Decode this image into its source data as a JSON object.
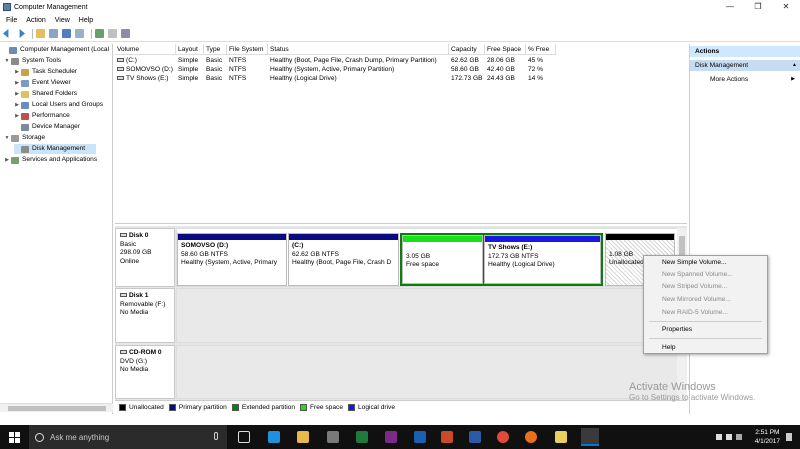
{
  "window": {
    "title": "Computer Management",
    "min_glyph": "—",
    "max_glyph": "❐",
    "close_glyph": "✕"
  },
  "menu": [
    "File",
    "Action",
    "View",
    "Help"
  ],
  "tree": {
    "items": [
      {
        "label": "Computer Management (Local",
        "exp": "",
        "indent": 0,
        "selected": false
      },
      {
        "label": "System Tools",
        "exp": "▼",
        "indent": 1,
        "selected": false
      },
      {
        "label": "Task Scheduler",
        "exp": "▶",
        "indent": 2,
        "selected": false
      },
      {
        "label": "Event Viewer",
        "exp": "▶",
        "indent": 2,
        "selected": false
      },
      {
        "label": "Shared Folders",
        "exp": "▶",
        "indent": 2,
        "selected": false
      },
      {
        "label": "Local Users and Groups",
        "exp": "▶",
        "indent": 2,
        "selected": false
      },
      {
        "label": "Performance",
        "exp": "▶",
        "indent": 2,
        "selected": false
      },
      {
        "label": "Device Manager",
        "exp": "",
        "indent": 2,
        "selected": false
      },
      {
        "label": "Storage",
        "exp": "▼",
        "indent": 1,
        "selected": false
      },
      {
        "label": "Disk Management",
        "exp": "",
        "indent": 2,
        "selected": true
      },
      {
        "label": "Services and Applications",
        "exp": "▶",
        "indent": 1,
        "selected": false
      }
    ]
  },
  "volumes": {
    "columns": [
      "Volume",
      "Layout",
      "Type",
      "File System",
      "Status",
      "Capacity",
      "Free Space",
      "% Free"
    ],
    "rows": [
      [
        "(C:)",
        "Simple",
        "Basic",
        "NTFS",
        "Healthy (Boot, Page File, Crash Dump, Primary Partition)",
        "62.62 GB",
        "28.06 GB",
        "45 %"
      ],
      [
        "SOMOVSO (D:)",
        "Simple",
        "Basic",
        "NTFS",
        "Healthy (System, Active, Primary Partition)",
        "58.60 GB",
        "42.40 GB",
        "72 %"
      ],
      [
        "TV Shows (E:)",
        "Simple",
        "Basic",
        "NTFS",
        "Healthy (Logical Drive)",
        "172.73 GB",
        "24.43 GB",
        "14 %"
      ]
    ]
  },
  "disks": [
    {
      "name": "Disk 0",
      "lines": [
        "Basic",
        "298.09 GB",
        "Online"
      ]
    },
    {
      "name": "Disk 1",
      "lines": [
        "Removable (F:)",
        "",
        "No Media"
      ]
    },
    {
      "name": "CD-ROM 0",
      "lines": [
        "DVD (G:)",
        "",
        "No Media"
      ]
    }
  ],
  "partitions": [
    {
      "title": "SOMOVSO  (D:)",
      "l2": "58.60 GB NTFS",
      "l3": "Healthy (System, Active, Primary",
      "bar": "#0a0a82"
    },
    {
      "title": "(C:)",
      "l2": "62.62 GB NTFS",
      "l3": "Healthy (Boot, Page File, Crash D",
      "bar": "#0a0a82"
    },
    {
      "title": "",
      "l2": "3.05 GB",
      "l3": "Free space",
      "bar": "#19e019"
    },
    {
      "title": "TV Shows  (E:)",
      "l2": "172.73 GB NTFS",
      "l3": "Healthy (Logical Drive)",
      "bar": "#1818e0"
    },
    {
      "title": "",
      "l2": "1.08 GB",
      "l3": "Unallocated",
      "bar": "#000000"
    }
  ],
  "legend": [
    {
      "label": "Unallocated",
      "color": "#000000"
    },
    {
      "label": "Primary partition",
      "color": "#0a0a82"
    },
    {
      "label": "Extended partition",
      "color": "#0a7f0a"
    },
    {
      "label": "Free space",
      "color": "#19e019"
    },
    {
      "label": "Logical drive",
      "color": "#1818e0"
    }
  ],
  "actions": {
    "header": "Actions",
    "section": "Disk Management",
    "more": "More Actions",
    "more_arrow": "▶",
    "section_arrow": "▲"
  },
  "context_menu": [
    {
      "label": "New Simple Volume...",
      "enabled": true
    },
    {
      "label": "New Spanned Volume...",
      "enabled": false
    },
    {
      "label": "New Striped Volume...",
      "enabled": false
    },
    {
      "label": "New Mirrored Volume...",
      "enabled": false
    },
    {
      "label": "New RAID-5 Volume...",
      "enabled": false
    },
    {
      "label": "Properties",
      "enabled": true
    },
    {
      "label": "Help",
      "enabled": true
    }
  ],
  "watermark": {
    "line1": "Activate Windows",
    "line2": "Go to Settings to activate Windows."
  },
  "taskbar": {
    "search_placeholder": "Ask me anything",
    "time": "2:51 PM",
    "date": "4/1/2017"
  },
  "colors": {
    "accent": "#0078d7",
    "selection": "#cce4f7",
    "action_header": "#cde8ff",
    "action_section": "#c6dcf2"
  }
}
